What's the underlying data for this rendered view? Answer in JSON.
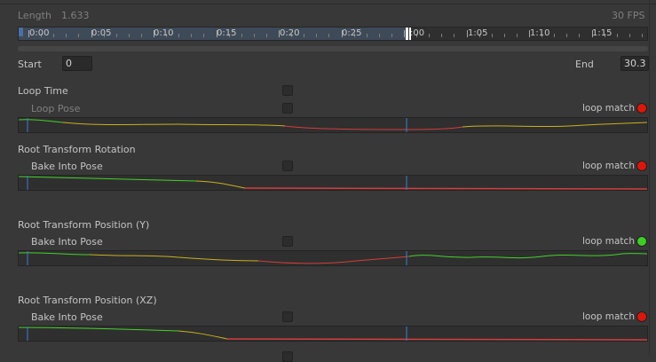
{
  "header": {
    "length_label": "Length",
    "length_value": "1.633",
    "fps": "30 FPS"
  },
  "timeline": {
    "labels": [
      "0:00",
      "0:05",
      "0:10",
      "0:15",
      "0:20",
      "0:25",
      ":00",
      "1:05",
      "1:10",
      "1:15"
    ]
  },
  "range": {
    "start_label": "Start",
    "start_value": "0",
    "end_label": "End",
    "end_value": "30.3"
  },
  "sections": [
    {
      "title": "Loop Time",
      "option": "Loop Pose",
      "loop_match_label": "loop match",
      "status_color": "#e0150a"
    },
    {
      "title": "Root Transform Rotation",
      "option": "Bake Into Pose",
      "loop_match_label": "loop match",
      "status_color": "#e0150a"
    },
    {
      "title": "Root Transform Position (Y)",
      "option": "Bake Into Pose",
      "loop_match_label": "loop match",
      "status_color": "#3ccf22"
    },
    {
      "title": "Root Transform Position (XZ)",
      "option": "Bake Into Pose",
      "loop_match_label": "loop match",
      "status_color": "#e0150a"
    }
  ],
  "colors": {
    "curve_good": "#44d12a",
    "curve_warn": "#c8b020",
    "curve_bad": "#d43d3d",
    "marker": "#3c7cd6"
  }
}
